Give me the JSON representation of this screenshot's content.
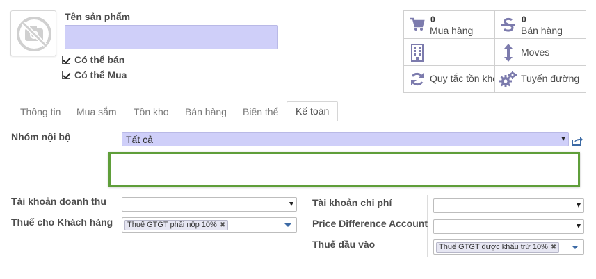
{
  "header": {
    "name_label": "Tên sản phẩm",
    "name_value": "",
    "can_be_sold": {
      "label": "Có thể bán",
      "checked": true
    },
    "can_be_purchased": {
      "label": "Có thể Mua",
      "checked": true
    }
  },
  "smart_buttons": [
    {
      "icon": "shopping-cart-icon",
      "count": "0",
      "label": "Mua hàng"
    },
    {
      "icon": "dollar-strike-icon",
      "count": "0",
      "label": "Bán hàng"
    },
    {
      "icon": "building-icon",
      "count": "",
      "label": ""
    },
    {
      "icon": "vertical-arrows-icon",
      "count": "",
      "label": "Moves"
    },
    {
      "icon": "refresh-icon",
      "count": "",
      "label": "Quy tắc tồn kho"
    },
    {
      "icon": "gears-icon",
      "count": "",
      "label": "Tuyến đường"
    }
  ],
  "tabs": [
    {
      "label": "Thông tin",
      "active": false
    },
    {
      "label": "Mua sắm",
      "active": false
    },
    {
      "label": "Tồn kho",
      "active": false
    },
    {
      "label": "Bán hàng",
      "active": false
    },
    {
      "label": "Biến thể",
      "active": false
    },
    {
      "label": "Kế toán",
      "active": true
    }
  ],
  "accounting": {
    "internal_category": {
      "label": "Nhóm nội bộ",
      "value": "Tất cả"
    },
    "income_account": {
      "label": "Tài khoản doanh thu",
      "value": ""
    },
    "customer_taxes": {
      "label": "Thuế cho Khách hàng",
      "tag": "Thuế GTGT phải nộp 10%"
    },
    "expense_account": {
      "label": "Tài khoản chi phí",
      "value": ""
    },
    "price_difference_account": {
      "label": "Price Difference Account",
      "value": ""
    },
    "vendor_taxes": {
      "label": "Thuế đầu vào",
      "tag": "Thuế GTGT được khấu trừ 10%"
    }
  },
  "colors": {
    "required_field": "#cfcff9",
    "highlight_border": "#5f9e3a",
    "icon": "#7c7bad"
  }
}
